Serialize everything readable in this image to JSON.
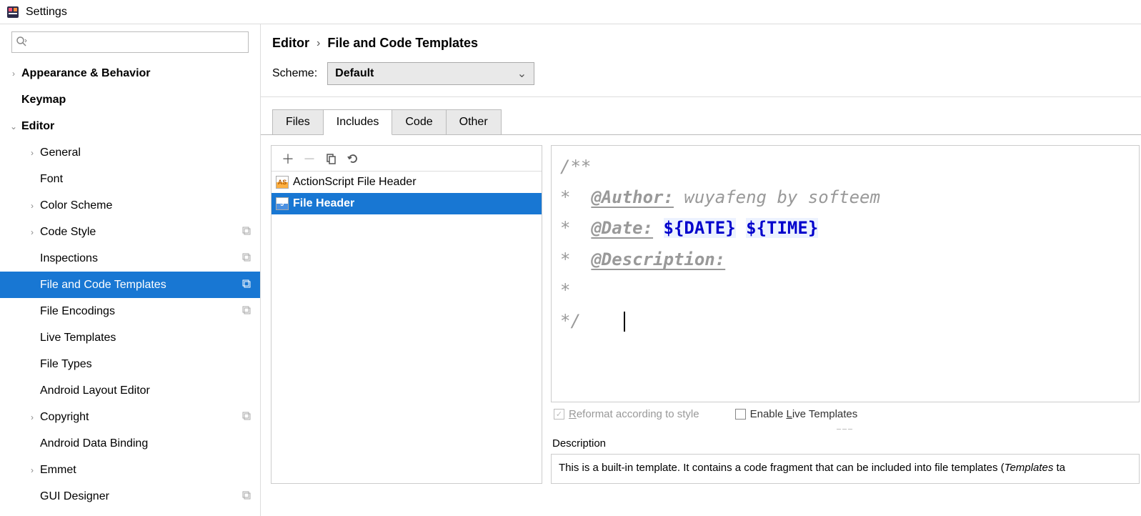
{
  "window": {
    "title": "Settings"
  },
  "search": {
    "placeholder": ""
  },
  "tree": {
    "items": [
      {
        "label": "Appearance & Behavior",
        "level": 0,
        "chev": "›",
        "bold": true
      },
      {
        "label": "Keymap",
        "level": 0,
        "chev": "",
        "bold": true
      },
      {
        "label": "Editor",
        "level": 0,
        "chev": "⌄",
        "bold": true
      },
      {
        "label": "General",
        "level": 1,
        "chev": "›"
      },
      {
        "label": "Font",
        "level": 1,
        "chev": ""
      },
      {
        "label": "Color Scheme",
        "level": 1,
        "chev": "›"
      },
      {
        "label": "Code Style",
        "level": 1,
        "chev": "›",
        "stack": true
      },
      {
        "label": "Inspections",
        "level": 1,
        "chev": "",
        "stack": true
      },
      {
        "label": "File and Code Templates",
        "level": 1,
        "chev": "",
        "stack": true,
        "selected": true
      },
      {
        "label": "File Encodings",
        "level": 1,
        "chev": "",
        "stack": true
      },
      {
        "label": "Live Templates",
        "level": 1,
        "chev": ""
      },
      {
        "label": "File Types",
        "level": 1,
        "chev": ""
      },
      {
        "label": "Android Layout Editor",
        "level": 1,
        "chev": ""
      },
      {
        "label": "Copyright",
        "level": 1,
        "chev": "›",
        "stack": true
      },
      {
        "label": "Android Data Binding",
        "level": 1,
        "chev": ""
      },
      {
        "label": "Emmet",
        "level": 1,
        "chev": "›"
      },
      {
        "label": "GUI Designer",
        "level": 1,
        "chev": "",
        "stack": true
      }
    ]
  },
  "breadcrumb": {
    "root": "Editor",
    "leaf": "File and Code Templates"
  },
  "scheme": {
    "label": "Scheme:",
    "value": "Default"
  },
  "tabs": [
    "Files",
    "Includes",
    "Code",
    "Other"
  ],
  "activeTab": "Includes",
  "templateList": [
    {
      "label": "ActionScript File Header",
      "icon": "orange"
    },
    {
      "label": "File Header",
      "icon": "blue",
      "selected": true
    }
  ],
  "editorLines": {
    "l0": "/**",
    "l1_star": "*  ",
    "l1_tag": "@Author:",
    "l1_rest": " wuyafeng by softeem",
    "l2_star": "*  ",
    "l2_tag": "@Date:",
    "l2_sp": " ",
    "l2_var1": "${DATE}",
    "l2_sp2": " ",
    "l2_var2": "${TIME}",
    "l3_star": "*  ",
    "l3_tag": "@Description:",
    "l4": "*",
    "l5": "*/"
  },
  "options": {
    "reformat": "Reformat according to style",
    "enableLive": "Enable Live Templates"
  },
  "desc": {
    "label": "Description",
    "text_a": "This is a built-in template. It contains a code fragment that can be included into file templates (",
    "text_b": "Templates",
    "text_c": " ta"
  }
}
